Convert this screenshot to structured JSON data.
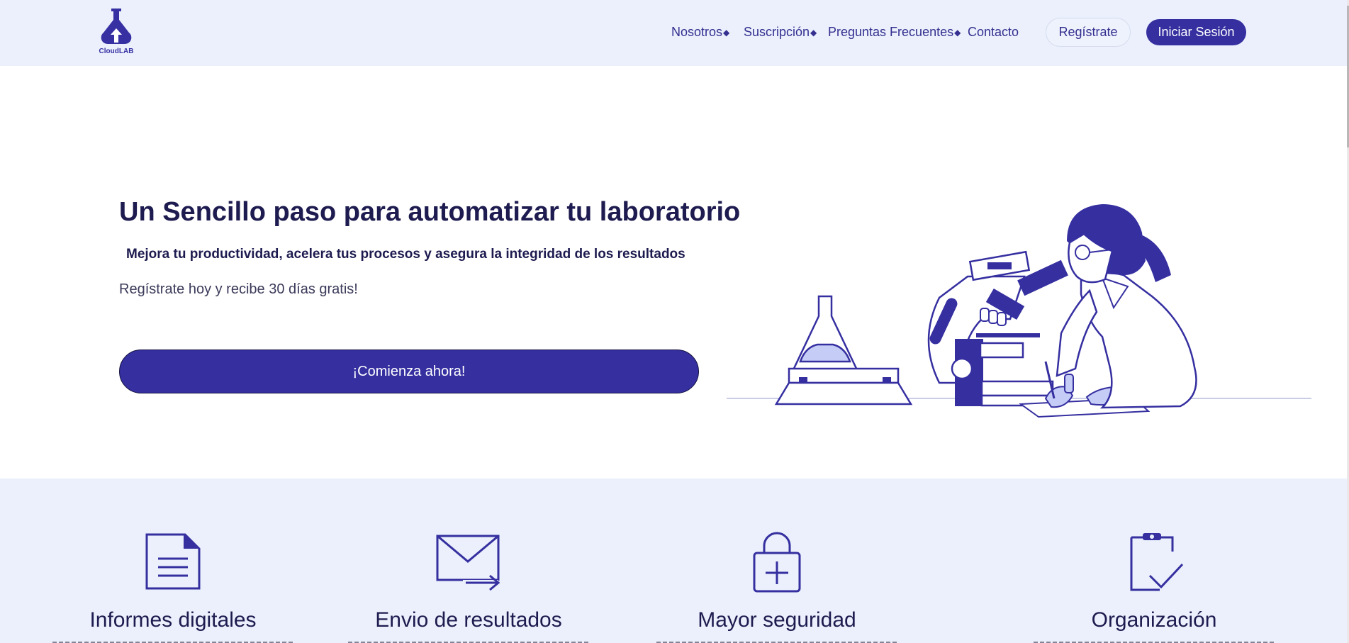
{
  "header": {
    "logo_text": "CloudLAB",
    "logo_icon": "flask-upload-icon",
    "nav": [
      {
        "label": "Nosotros",
        "has_dropdown": true
      },
      {
        "label": "Suscripción",
        "has_dropdown": true
      },
      {
        "label": "Preguntas Frecuentes",
        "has_dropdown": true
      },
      {
        "label": "Contacto",
        "has_dropdown": false
      }
    ],
    "dropdown_glyph": "◆",
    "register_label": "Regístrate",
    "login_label": "Iniciar Sesión"
  },
  "hero": {
    "title": "Un Sencillo paso para automatizar tu laboratorio",
    "subtitle": "Mejora tu productividad, acelera tus procesos y asegura la integridad de los resultados",
    "text": "Regístrate hoy y recibe 30 días gratis!",
    "cta_label": "¡Comienza ahora!",
    "illustration": "scientist-microscope-illustration"
  },
  "features": [
    {
      "icon": "document-icon",
      "title": "Informes digitales"
    },
    {
      "icon": "mail-send-icon",
      "title": "Envio de resultados"
    },
    {
      "icon": "lock-plus-icon",
      "title": "Mayor seguridad"
    },
    {
      "icon": "clipboard-check-icon",
      "title": "Organización"
    }
  ],
  "colors": {
    "primary": "#352fa0",
    "header_bg": "#ebf0fc",
    "text_dark": "#1d1b4f",
    "accent_light": "#c5cdf6"
  }
}
